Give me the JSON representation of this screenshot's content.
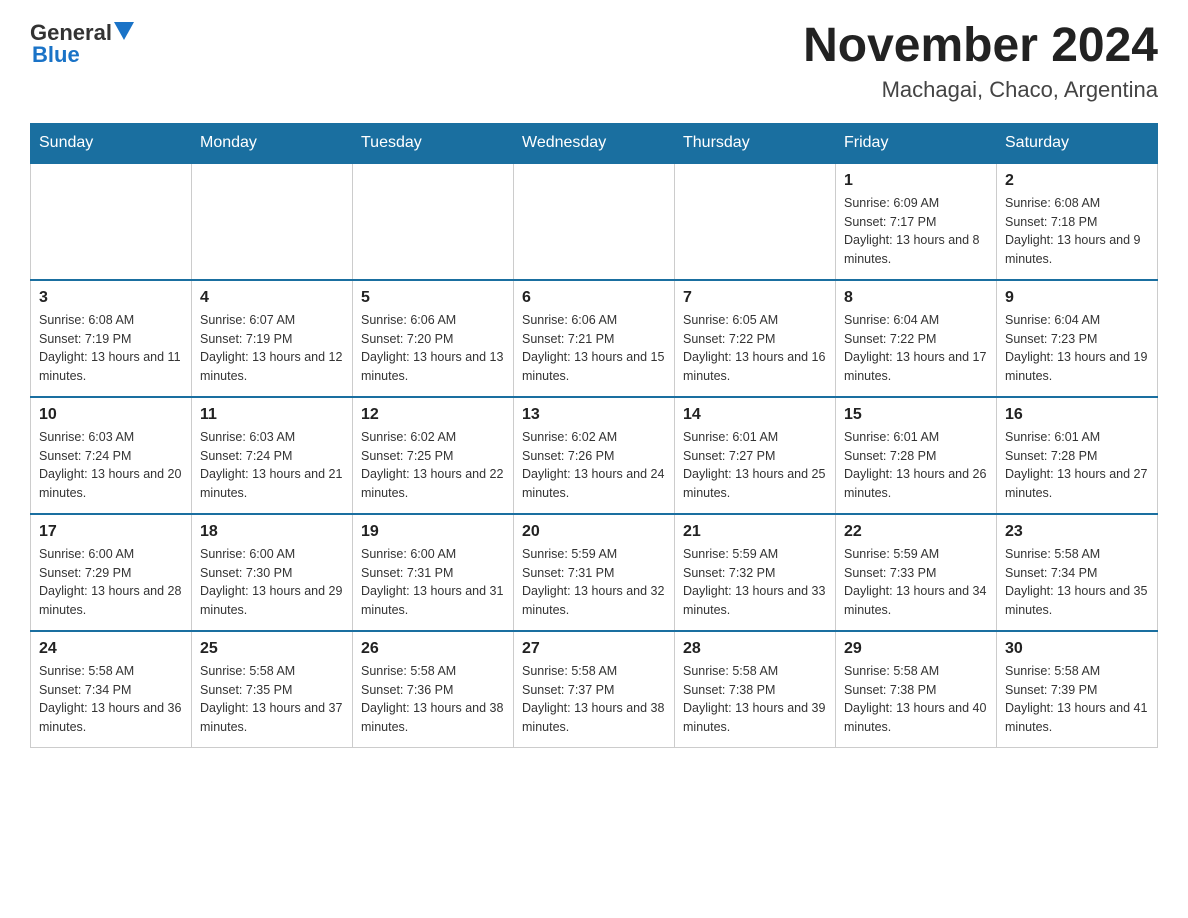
{
  "header": {
    "logo_general": "General",
    "logo_blue": "Blue",
    "month_title": "November 2024",
    "location": "Machagai, Chaco, Argentina"
  },
  "weekdays": [
    "Sunday",
    "Monday",
    "Tuesday",
    "Wednesday",
    "Thursday",
    "Friday",
    "Saturday"
  ],
  "weeks": [
    [
      {
        "day": "",
        "info": ""
      },
      {
        "day": "",
        "info": ""
      },
      {
        "day": "",
        "info": ""
      },
      {
        "day": "",
        "info": ""
      },
      {
        "day": "",
        "info": ""
      },
      {
        "day": "1",
        "info": "Sunrise: 6:09 AM\nSunset: 7:17 PM\nDaylight: 13 hours and 8 minutes."
      },
      {
        "day": "2",
        "info": "Sunrise: 6:08 AM\nSunset: 7:18 PM\nDaylight: 13 hours and 9 minutes."
      }
    ],
    [
      {
        "day": "3",
        "info": "Sunrise: 6:08 AM\nSunset: 7:19 PM\nDaylight: 13 hours and 11 minutes."
      },
      {
        "day": "4",
        "info": "Sunrise: 6:07 AM\nSunset: 7:19 PM\nDaylight: 13 hours and 12 minutes."
      },
      {
        "day": "5",
        "info": "Sunrise: 6:06 AM\nSunset: 7:20 PM\nDaylight: 13 hours and 13 minutes."
      },
      {
        "day": "6",
        "info": "Sunrise: 6:06 AM\nSunset: 7:21 PM\nDaylight: 13 hours and 15 minutes."
      },
      {
        "day": "7",
        "info": "Sunrise: 6:05 AM\nSunset: 7:22 PM\nDaylight: 13 hours and 16 minutes."
      },
      {
        "day": "8",
        "info": "Sunrise: 6:04 AM\nSunset: 7:22 PM\nDaylight: 13 hours and 17 minutes."
      },
      {
        "day": "9",
        "info": "Sunrise: 6:04 AM\nSunset: 7:23 PM\nDaylight: 13 hours and 19 minutes."
      }
    ],
    [
      {
        "day": "10",
        "info": "Sunrise: 6:03 AM\nSunset: 7:24 PM\nDaylight: 13 hours and 20 minutes."
      },
      {
        "day": "11",
        "info": "Sunrise: 6:03 AM\nSunset: 7:24 PM\nDaylight: 13 hours and 21 minutes."
      },
      {
        "day": "12",
        "info": "Sunrise: 6:02 AM\nSunset: 7:25 PM\nDaylight: 13 hours and 22 minutes."
      },
      {
        "day": "13",
        "info": "Sunrise: 6:02 AM\nSunset: 7:26 PM\nDaylight: 13 hours and 24 minutes."
      },
      {
        "day": "14",
        "info": "Sunrise: 6:01 AM\nSunset: 7:27 PM\nDaylight: 13 hours and 25 minutes."
      },
      {
        "day": "15",
        "info": "Sunrise: 6:01 AM\nSunset: 7:28 PM\nDaylight: 13 hours and 26 minutes."
      },
      {
        "day": "16",
        "info": "Sunrise: 6:01 AM\nSunset: 7:28 PM\nDaylight: 13 hours and 27 minutes."
      }
    ],
    [
      {
        "day": "17",
        "info": "Sunrise: 6:00 AM\nSunset: 7:29 PM\nDaylight: 13 hours and 28 minutes."
      },
      {
        "day": "18",
        "info": "Sunrise: 6:00 AM\nSunset: 7:30 PM\nDaylight: 13 hours and 29 minutes."
      },
      {
        "day": "19",
        "info": "Sunrise: 6:00 AM\nSunset: 7:31 PM\nDaylight: 13 hours and 31 minutes."
      },
      {
        "day": "20",
        "info": "Sunrise: 5:59 AM\nSunset: 7:31 PM\nDaylight: 13 hours and 32 minutes."
      },
      {
        "day": "21",
        "info": "Sunrise: 5:59 AM\nSunset: 7:32 PM\nDaylight: 13 hours and 33 minutes."
      },
      {
        "day": "22",
        "info": "Sunrise: 5:59 AM\nSunset: 7:33 PM\nDaylight: 13 hours and 34 minutes."
      },
      {
        "day": "23",
        "info": "Sunrise: 5:58 AM\nSunset: 7:34 PM\nDaylight: 13 hours and 35 minutes."
      }
    ],
    [
      {
        "day": "24",
        "info": "Sunrise: 5:58 AM\nSunset: 7:34 PM\nDaylight: 13 hours and 36 minutes."
      },
      {
        "day": "25",
        "info": "Sunrise: 5:58 AM\nSunset: 7:35 PM\nDaylight: 13 hours and 37 minutes."
      },
      {
        "day": "26",
        "info": "Sunrise: 5:58 AM\nSunset: 7:36 PM\nDaylight: 13 hours and 38 minutes."
      },
      {
        "day": "27",
        "info": "Sunrise: 5:58 AM\nSunset: 7:37 PM\nDaylight: 13 hours and 38 minutes."
      },
      {
        "day": "28",
        "info": "Sunrise: 5:58 AM\nSunset: 7:38 PM\nDaylight: 13 hours and 39 minutes."
      },
      {
        "day": "29",
        "info": "Sunrise: 5:58 AM\nSunset: 7:38 PM\nDaylight: 13 hours and 40 minutes."
      },
      {
        "day": "30",
        "info": "Sunrise: 5:58 AM\nSunset: 7:39 PM\nDaylight: 13 hours and 41 minutes."
      }
    ]
  ]
}
